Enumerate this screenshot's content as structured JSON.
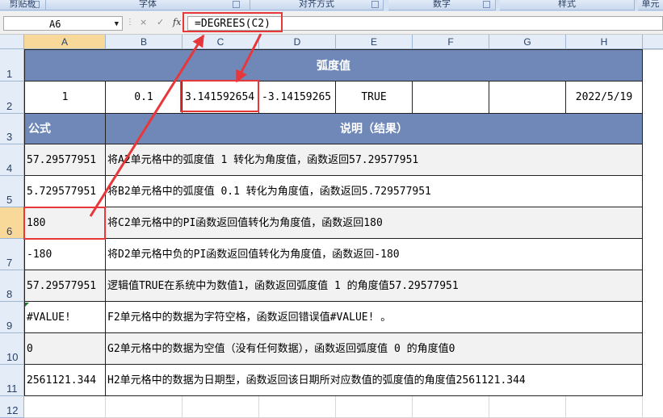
{
  "ribbon": {
    "groups": [
      "剪贴板",
      "字体",
      "对齐方式",
      "数字",
      "样式",
      "单元"
    ]
  },
  "formula_bar": {
    "name_box": "A6",
    "fx_label": "fx",
    "cancel_icon": "×",
    "enter_icon": "✓",
    "formula": "=DEGREES(C2)"
  },
  "columns": [
    "A",
    "B",
    "C",
    "D",
    "E",
    "F",
    "G",
    "H"
  ],
  "rows": [
    "1",
    "2",
    "3",
    "4",
    "5",
    "6",
    "7",
    "8",
    "9",
    "10",
    "11",
    "12"
  ],
  "sheet": {
    "title": "弧度值",
    "values": [
      "1",
      "0.1",
      "3.141592654",
      "-3.14159265",
      "TRUE",
      "",
      "",
      "2022/5/19"
    ],
    "col_formula": "公式",
    "col_desc": "说明（结果）",
    "records": [
      {
        "result": "57.29577951",
        "desc": "将A2单元格中的弧度值 1 转化为角度值，函数返回57.29577951"
      },
      {
        "result": "5.729577951",
        "desc": "将B2单元格中的弧度值 0.1 转化为角度值，函数返回5.729577951"
      },
      {
        "result": "180",
        "desc": "将C2单元格中的PI函数返回值转化为角度值，函数返回180"
      },
      {
        "result": "-180",
        "desc": "将D2单元格中负的PI函数返回值转化为角度值，函数返回-180"
      },
      {
        "result": "57.29577951",
        "desc": "逻辑值TRUE在系统中为数值1，函数返回弧度值 1 的角度值57.29577951"
      },
      {
        "result": "#VALUE!",
        "desc": "F2单元格中的数据为字符空格，函数返回错误值#VALUE! 。"
      },
      {
        "result": "0",
        "desc": "G2单元格中的数据为空值（没有任何数据），函数返回弧度值 0 的角度值0"
      },
      {
        "result": "2561121.344",
        "desc": "H2单元格中的数据为日期型，函数返回该日期所对应数值的弧度值的角度值2561121.344"
      }
    ]
  },
  "colors": {
    "header_band": "#6f88b8",
    "annotation_red": "#e8373b",
    "selected_header": "#f9d99a"
  }
}
